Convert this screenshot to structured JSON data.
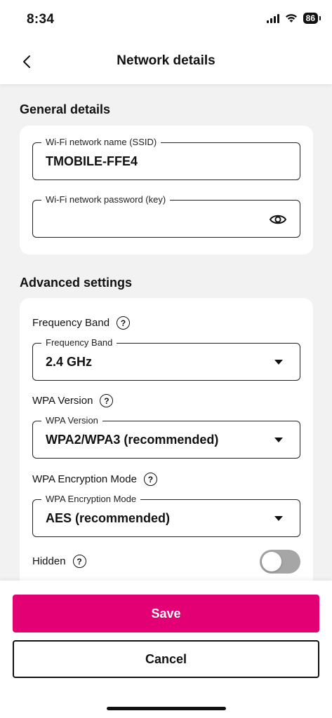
{
  "status_bar": {
    "time": "8:34",
    "battery": "86",
    "icons": [
      "signal-icon",
      "wifi-icon",
      "battery-icon"
    ]
  },
  "header": {
    "title": "Network details",
    "back_icon": "chevron-left-icon"
  },
  "general": {
    "title": "General details",
    "ssid": {
      "label": "Wi‑Fi network name (SSID)",
      "value": "TMOBILE-FFE4"
    },
    "password": {
      "label": "Wi‑Fi network password (key)",
      "value": "",
      "icon": "eye-icon"
    }
  },
  "advanced": {
    "title": "Advanced settings",
    "frequency": {
      "row_label": "Frequency Band",
      "label": "Frequency Band",
      "value": "2.4 GHz"
    },
    "wpa_version": {
      "row_label": "WPA Version",
      "label": "WPA Version",
      "value": "WPA2/WPA3 (recommended)"
    },
    "encryption": {
      "row_label": "WPA Encryption Mode",
      "label": "WPA Encryption Mode",
      "value": "AES (recommended)"
    },
    "hidden": {
      "label": "Hidden",
      "enabled": false
    },
    "help_glyph": "?"
  },
  "actions": {
    "save": "Save",
    "cancel": "Cancel"
  },
  "colors": {
    "brand": "#e20074",
    "toggle_off": "#a6a6a6",
    "background": "#f2f2f2"
  }
}
